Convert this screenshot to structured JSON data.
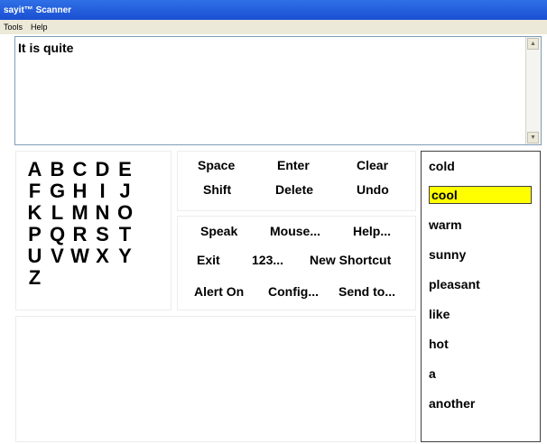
{
  "window": {
    "title": "sayit™ Scanner"
  },
  "menu": {
    "items": [
      "Tools",
      "Help"
    ]
  },
  "text_area": {
    "value": "It is quite"
  },
  "letters": [
    "A",
    "B",
    "C",
    "D",
    "E",
    "F",
    "G",
    "H",
    "I",
    "J",
    "K",
    "L",
    "M",
    "N",
    "O",
    "P",
    "Q",
    "R",
    "S",
    "T",
    "U",
    "V",
    "W",
    "X",
    "Y",
    "Z"
  ],
  "commands_top": {
    "space": "Space",
    "enter": "Enter",
    "clear": "Clear",
    "shift": "Shift",
    "delete": "Delete",
    "undo": "Undo"
  },
  "commands_bottom": {
    "speak": "Speak",
    "mouse": "Mouse...",
    "help": "Help...",
    "exit": "Exit",
    "numbers": "123...",
    "new_shortcut": "New Shortcut",
    "alert": "Alert On",
    "config": "Config...",
    "send_to": "Send to..."
  },
  "predictions": {
    "highlight_color": "#ffff00",
    "selected": "cool",
    "words": [
      "cold",
      "cool",
      "warm",
      "sunny",
      "pleasant",
      "like",
      "hot",
      "a",
      "another"
    ]
  }
}
